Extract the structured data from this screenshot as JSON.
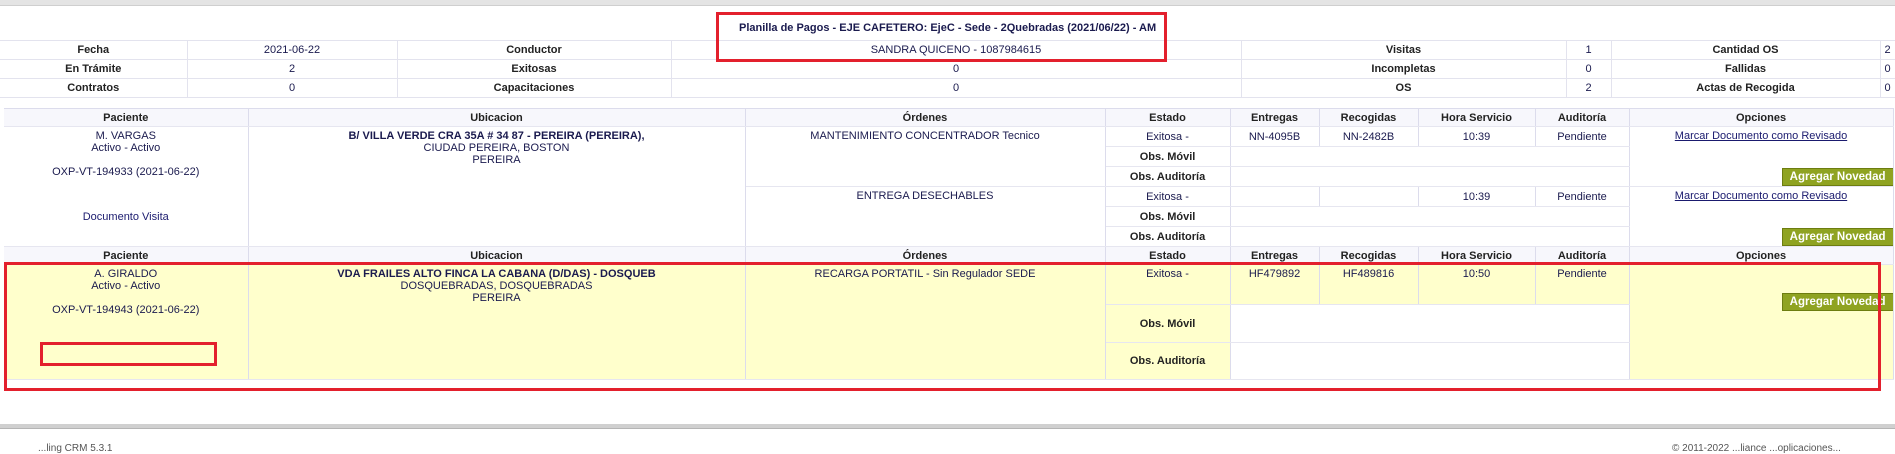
{
  "planilla": {
    "title": "Planilla de Pagos - EJE CAFETERO: EjeC - Sede - 2Quebradas (2021/06/22) - AM",
    "summary_rows": [
      [
        {
          "label": "Fecha",
          "value": "2021-06-22"
        },
        {
          "label": "Conductor",
          "value": "SANDRA QUICENO - 1087984615"
        },
        {
          "label": "Visitas",
          "value": "1"
        },
        {
          "label": "Cantidad OS",
          "value": "2"
        }
      ],
      [
        {
          "label": "En Trámite",
          "value": "2"
        },
        {
          "label": "Exitosas",
          "value": "0"
        },
        {
          "label": "Incompletas",
          "value": "0"
        },
        {
          "label": "Fallidas",
          "value": "0"
        }
      ],
      [
        {
          "label": "Contratos",
          "value": "0"
        },
        {
          "label": "Capacitaciones",
          "value": "0"
        },
        {
          "label": "OS",
          "value": "2"
        },
        {
          "label": "Actas de Recogida",
          "value": "0"
        }
      ]
    ]
  },
  "columns": {
    "paciente": "Paciente",
    "ubicacion": "Ubicacion",
    "ordenes": "Órdenes",
    "estado": "Estado",
    "entregas": "Entregas",
    "recogidas": "Recogidas",
    "hora": "Hora Servicio",
    "auditoria": "Auditoría",
    "opciones": "Opciones"
  },
  "obs_movil_label": "Obs. Móvil",
  "obs_auditoria_label": "Obs. Auditoría",
  "mark_reviewed_label": "Marcar Documento como Revisado",
  "add_novedad_label": "Agregar Novedad",
  "visits": [
    {
      "patient_name": "M. VARGAS",
      "patient_status": "Activo - Activo",
      "doc_code": "OXP-VT-194933 (2021-06-22)",
      "doc_link": "Documento Visita",
      "address_line1": "B/ VILLA VERDE CRA 35A # 34 87 - PEREIRA (PEREIRA),",
      "address_line2": "CIUDAD PEREIRA, BOSTON",
      "address_line3": "PEREIRA",
      "orders": [
        {
          "order": "MANTENIMIENTO CONCENTRADOR Tecnico",
          "estado": "Exitosa -",
          "entregas": "NN-4095B",
          "recogidas": "NN-2482B",
          "hora": "10:39",
          "auditoria": "Pendiente"
        },
        {
          "order": "ENTREGA DESECHABLES",
          "estado": "Exitosa -",
          "entregas": "",
          "recogidas": "",
          "hora": "10:39",
          "auditoria": "Pendiente"
        }
      ]
    },
    {
      "patient_name": "A. GIRALDO",
      "patient_status": "Activo - Activo",
      "doc_code": "OXP-VT-194943 (2021-06-22)",
      "address_line1": "VDA FRAILES ALTO FINCA LA CABANA (D/DAS) - DOSQUEB",
      "address_line2": "DOSQUEBRADAS, DOSQUEBRADAS",
      "address_line3": "PEREIRA",
      "orders": [
        {
          "order": "RECARGA PORTATIL - Sin Regulador SEDE",
          "estado": "Exitosa -",
          "entregas": "HF479892",
          "recogidas": "HF489816",
          "hora": "10:50",
          "auditoria": "Pendiente"
        }
      ]
    }
  ],
  "footer": {
    "left": "...ling CRM 5.3.1",
    "right": "© 2011-2022 ...liance ...oplicaciones..."
  },
  "colors": {
    "annotation_red": "#e3202d",
    "highlight": "#ffffcc",
    "button_green": "#8fa321"
  }
}
